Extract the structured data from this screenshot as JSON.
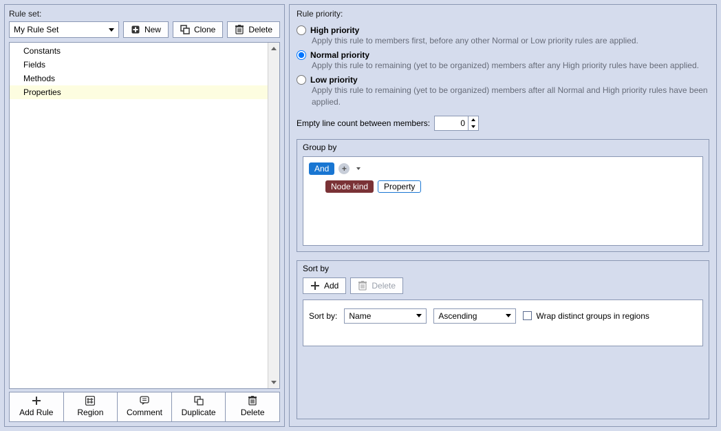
{
  "left": {
    "ruleset_label": "Rule set:",
    "ruleset_selected": "My Rule Set",
    "new_label": "New",
    "clone_label": "Clone",
    "delete_label": "Delete",
    "rules": [
      {
        "name": "Constants",
        "selected": false
      },
      {
        "name": "Fields",
        "selected": false
      },
      {
        "name": "Methods",
        "selected": false
      },
      {
        "name": "Properties",
        "selected": true
      }
    ],
    "toolbar": {
      "add_rule": "Add Rule",
      "region": "Region",
      "comment": "Comment",
      "duplicate": "Duplicate",
      "delete": "Delete"
    }
  },
  "right": {
    "priority_label": "Rule priority:",
    "options": [
      {
        "title": "High priority",
        "desc": "Apply this rule to members first, before any other Normal or Low priority rules are applied.",
        "checked": false
      },
      {
        "title": "Normal priority",
        "desc": "Apply this rule to remaining (yet to be organized) members after any High priority rules have been applied.",
        "checked": true
      },
      {
        "title": "Low priority",
        "desc": "Apply this rule to remaining (yet to be organized) members after all Normal and High priority rules have been applied.",
        "checked": false
      }
    ],
    "empty_line_label": "Empty line count between members:",
    "empty_line_value": "0",
    "groupby": {
      "legend": "Group by",
      "and": "And",
      "node_kind": "Node kind",
      "property": "Property"
    },
    "sortby": {
      "legend": "Sort by",
      "add": "Add",
      "delete": "Delete",
      "sort_by_label": "Sort by:",
      "field": "Name",
      "direction": "Ascending",
      "wrap_label": "Wrap distinct groups in regions",
      "wrap_checked": false
    }
  }
}
